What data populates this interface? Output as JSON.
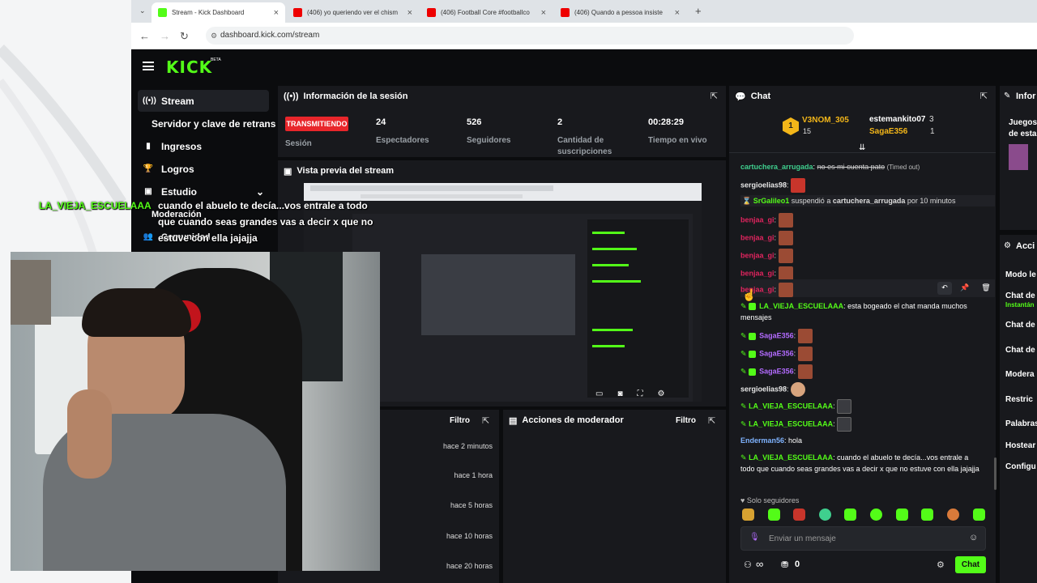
{
  "browser": {
    "tabs": [
      {
        "label": "Stream - Kick Dashboard",
        "active": true
      },
      {
        "label": "(406) yo queriendo ver el chism"
      },
      {
        "label": "(406) Football Core #footballco"
      },
      {
        "label": "(406) Quando a pessoa insiste"
      }
    ],
    "url": "dashboard.kick.com/stream"
  },
  "app": {
    "logo": "KICK",
    "logo_badge": "BETA"
  },
  "sidebar": {
    "items": [
      {
        "label": "Stream",
        "icon": "broadcast-icon"
      },
      {
        "label": "Servidor y clave de retransmisión",
        "icon": ""
      },
      {
        "label": "Ingresos",
        "icon": "chart-icon"
      },
      {
        "label": "Logros",
        "icon": "trophy-icon"
      },
      {
        "label": "Estudio",
        "icon": "studio-icon"
      },
      {
        "label": "Moderación",
        "icon": "shield-icon"
      },
      {
        "label": "Comunidad",
        "icon": "people-icon"
      }
    ]
  },
  "session": {
    "title": "Información de la sesión",
    "status_badge": "TRANSMITIENDO",
    "session_label": "Sesión",
    "stats": [
      {
        "value": "24",
        "label": "Espectadores"
      },
      {
        "value": "526",
        "label": "Seguidores"
      },
      {
        "value": "2",
        "label": "Cantidad de suscripciones"
      },
      {
        "value": "00:28:29",
        "label": "Tiempo en vivo"
      }
    ]
  },
  "preview": {
    "title": "Vista previa del stream"
  },
  "activity": {
    "filter_label": "Filtro",
    "times": [
      "hace 2 minutos",
      "hace 1 hora",
      "hace 5 horas",
      "hace 10 horas",
      "hace 20 horas"
    ]
  },
  "mod_actions": {
    "title": "Acciones de moderador",
    "filter_label": "Filtro"
  },
  "chat": {
    "title": "Chat",
    "pinned": {
      "top_name": "V3NOM_305",
      "top_count": "15",
      "gifters": [
        {
          "name": "estemankito07",
          "count": "3"
        },
        {
          "name": "SagaE356",
          "count": "1"
        }
      ]
    },
    "messages": [
      {
        "user": "cartuchera_arrugada",
        "text": "no es mi cuenta pato",
        "note": "(Timed out)",
        "color": "#53fc18"
      },
      {
        "user": "sergioelias98",
        "text": "",
        "color": "#e8e8e8"
      },
      {
        "system": "SrGalileo1",
        "system_text": "suspendió a",
        "target": "cartuchera_arrugada",
        "suffix": "por 10 minutos"
      },
      {
        "user": "benjaa_gi",
        "text": "",
        "color": "#e0245e"
      },
      {
        "user": "benjaa_gi",
        "text": "",
        "color": "#e0245e"
      },
      {
        "user": "benjaa_gi",
        "text": "",
        "color": "#e0245e"
      },
      {
        "user": "benjaa_gi",
        "text": "",
        "color": "#e0245e"
      },
      {
        "user": "benjaa_gi",
        "text": "",
        "color": "#e0245e"
      },
      {
        "user": "LA_VIEJA_ESCUELAAA",
        "text": "esta bogeado el chat manda muchos mensajes",
        "color": "#53fc18"
      },
      {
        "user": "SagaE356",
        "text": "",
        "color": "#b36bff"
      },
      {
        "user": "SagaE356",
        "text": "",
        "color": "#b36bff"
      },
      {
        "user": "SagaE356",
        "text": "",
        "color": "#b36bff"
      },
      {
        "user": "sergioelias98",
        "text": "",
        "color": "#e8e8e8"
      },
      {
        "user": "LA_VIEJA_ESCUELAAA",
        "text": "",
        "color": "#53fc18"
      },
      {
        "user": "LA_VIEJA_ESCUELAAA",
        "text": "",
        "color": "#53fc18"
      },
      {
        "user": "Enderman56",
        "text": "hola",
        "color": "#7fb3ff"
      },
      {
        "user": "LA_VIEJA_ESCUELAAA",
        "text": "cuando el abuelo te decía...vos entrale a todo que cuando seas grandes vas a decir x que no estuve con ella jajajja",
        "color": "#53fc18"
      }
    ],
    "followers_only": "Solo seguidores",
    "input_placeholder": "Enviar un mensaje",
    "infinity_label": "∞",
    "gift_count": "0",
    "send_label": "Chat"
  },
  "right_panel": {
    "info_title": "Infor",
    "games_label": "Juegos",
    "games_sub": "de esta",
    "actions_title": "Acci",
    "items": [
      "Modo le",
      "Chat de",
      "Instantán",
      "Chat de",
      "Chat de",
      "Modera",
      "Restric",
      "Palabras",
      "Hostear",
      "Configu"
    ]
  },
  "overlay": {
    "username": "LA_VIEJA_ESCUELAAA",
    "lines": [
      "cuando el abuelo te decía...vos entrale a todo",
      "que cuando seas grandes vas a decir x que no",
      "estuve con ella jajajja"
    ]
  },
  "colors": {
    "accent": "#53fc18",
    "live": "#e8262b",
    "panel": "#18191d",
    "bg": "#0b0c0e"
  }
}
